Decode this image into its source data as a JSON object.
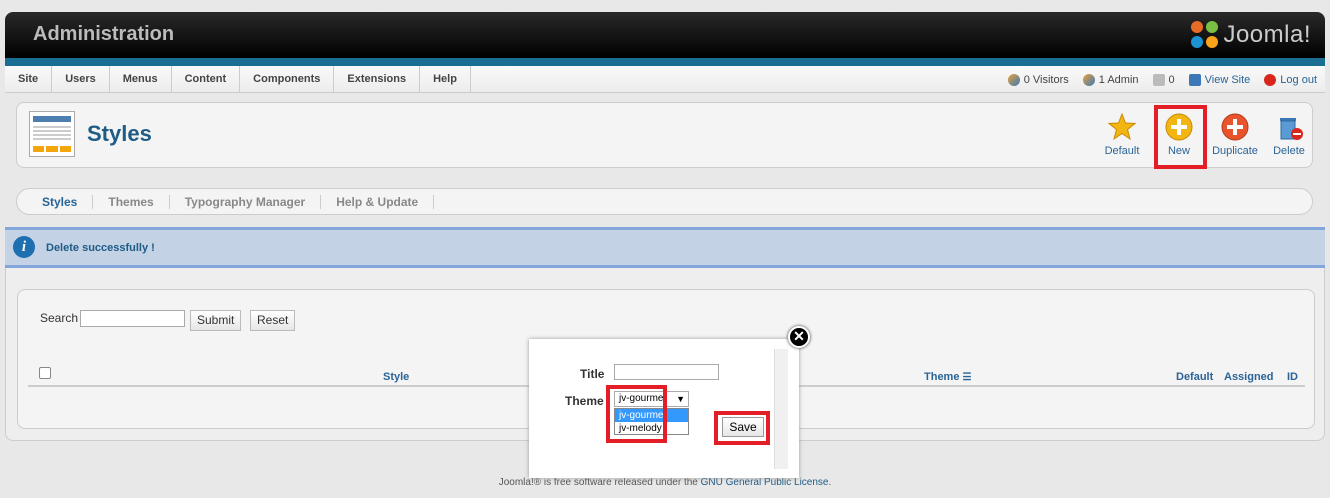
{
  "header": {
    "title": "Administration",
    "logo_text": "Joomla!"
  },
  "menu": {
    "items": [
      "Site",
      "Users",
      "Menus",
      "Content",
      "Components",
      "Extensions",
      "Help"
    ],
    "status": {
      "visitors": "0 Visitors",
      "admins": "1 Admin",
      "messages": "0",
      "view_site": "View Site",
      "logout": "Log out"
    }
  },
  "toolbar": {
    "page_title": "Styles",
    "buttons": {
      "default": "Default",
      "new": "New",
      "duplicate": "Duplicate",
      "delete": "Delete"
    }
  },
  "submenu": {
    "items": [
      "Styles",
      "Themes",
      "Typography Manager",
      "Help & Update"
    ]
  },
  "message": {
    "text": "Delete successfully !"
  },
  "filter": {
    "search_label": "Search",
    "search_value": "",
    "submit": "Submit",
    "reset": "Reset"
  },
  "table": {
    "columns": {
      "style": "Style",
      "theme": "Theme",
      "default": "Default",
      "assigned": "Assigned",
      "id": "ID"
    }
  },
  "footer": {
    "prefix": "Joomla!® is free software released under the ",
    "link": "GNU General Public License",
    "suffix": "."
  },
  "modal": {
    "title_label": "Title",
    "title_value": "",
    "theme_label": "Theme",
    "theme_selected": "jv-gourmet",
    "theme_options": [
      "jv-gourmet",
      "jv-melody"
    ],
    "save_label": "Save"
  },
  "colors": {
    "header_bg": "#000000",
    "stripe": "#1a6d93",
    "link": "#2a6496",
    "highlight": "#e41e26",
    "message_bg": "#c3d2e5"
  }
}
